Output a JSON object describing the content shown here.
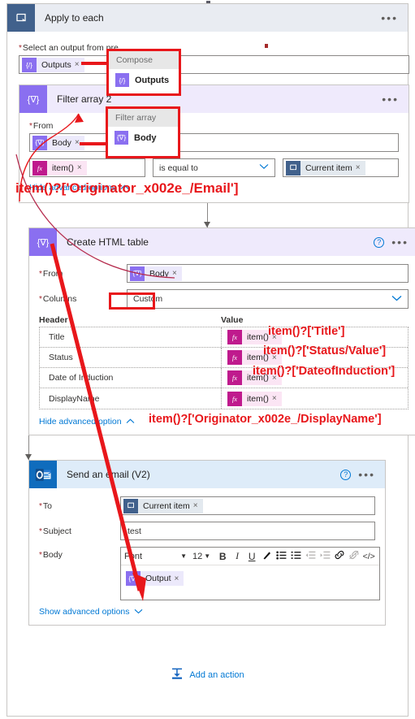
{
  "apply_to_each": {
    "title": "Apply to each",
    "icon": "loop-icon",
    "menu": "•••",
    "output_field": {
      "label": "Select an output from pre",
      "required_mark": "*",
      "token": {
        "icon": "{/}",
        "label": "Outputs",
        "remove": "×"
      }
    }
  },
  "filter_array": {
    "title": "Filter array 2",
    "icon": "filter-icon",
    "menu": "•••",
    "from": {
      "label": "From",
      "required_mark": "*",
      "token": {
        "icon": "{∇}",
        "label": "Body",
        "remove": "×"
      }
    },
    "condition": {
      "left_token": {
        "icon": "fx",
        "label": "item()",
        "remove": "×"
      },
      "operator": "is equal to",
      "operator_chevron": "⌄",
      "right_token": {
        "icon": "loop",
        "label": "Current item",
        "remove": "×"
      }
    },
    "advanced_link": "Hide advanced options",
    "advanced_chevron": "⌃"
  },
  "create_html_table": {
    "title": "Create HTML table",
    "icon": "filter-icon",
    "help": "?",
    "menu": "•••",
    "from": {
      "label": "From",
      "required_mark": "*",
      "token": {
        "icon": "{∇}",
        "label": "Body",
        "remove": "×"
      }
    },
    "columns": {
      "label": "Columns",
      "required_mark": "*",
      "value": "Custom",
      "chevron": "⌄"
    },
    "table": {
      "header_col": "Header",
      "value_col": "Value",
      "rows": [
        {
          "header": "Title",
          "value_token": {
            "icon": "fx",
            "label": "item()",
            "remove": "×"
          },
          "has_delete": true,
          "delete": "×"
        },
        {
          "header": "Status",
          "value_token": {
            "icon": "fx",
            "label": "item()",
            "remove": "×"
          },
          "has_delete": false,
          "delete": ""
        },
        {
          "header": "Date of Induction",
          "value_token": {
            "icon": "fx",
            "label": "item()",
            "remove": "×"
          },
          "has_delete": false,
          "delete": ""
        },
        {
          "header": "DisplayName",
          "value_token": {
            "icon": "fx",
            "label": "item()",
            "remove": "×"
          },
          "has_delete": false,
          "delete": ""
        }
      ]
    },
    "advanced_link": "Hide advanced option",
    "advanced_chevron": "⌃"
  },
  "send_email": {
    "title": "Send an email (V2)",
    "icon": "outlook-icon",
    "help": "?",
    "menu": "•••",
    "to": {
      "label": "To",
      "required_mark": "*",
      "token": {
        "icon": "loop",
        "label": "Current item",
        "remove": "×"
      }
    },
    "subject": {
      "label": "Subject",
      "required_mark": "*",
      "value": "test"
    },
    "body": {
      "label": "Body",
      "required_mark": "*",
      "toolbar": {
        "font_name": "Font",
        "font_caret": "▼",
        "font_size": "12",
        "size_caret": "▼",
        "bold": "B",
        "italic": "I",
        "underline": "U",
        "text_color": "✐",
        "bullet_list": "≡",
        "number_list": "≣",
        "outdent": "⮌",
        "indent": "⮍",
        "link": "ὑ7",
        "unlink": "⛓",
        "code": "</>"
      },
      "token": {
        "icon": "{∇}",
        "label": "Output",
        "remove": "×"
      }
    },
    "advanced_link": "Show advanced options",
    "advanced_chevron": "⌄"
  },
  "add_action": {
    "label": "Add an action",
    "icon": "download-into-icon"
  },
  "popups": [
    {
      "name": "compose-popup",
      "header": "Compose",
      "item_icon": "{/}",
      "item_label": "Outputs"
    },
    {
      "name": "filter-array-popup",
      "header": "Filter array",
      "item_icon": "{∇}",
      "item_label": "Body"
    }
  ],
  "annotations": {
    "email_expr": "item()?['Originator_x002e_/Email']",
    "title_expr": "item()?['Title']",
    "status_expr": "item()?['Status/Value']",
    "date_expr": "item()?['DateofInduction']",
    "displayname_expr": "item()?['Originator_x002e_/DisplayName']",
    "color": "#e8171b"
  }
}
